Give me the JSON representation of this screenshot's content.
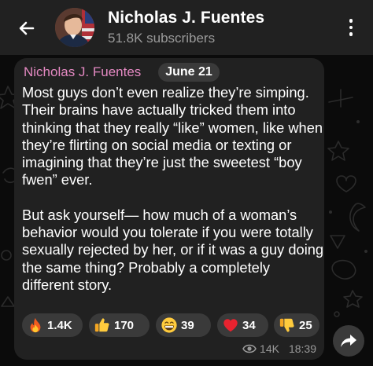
{
  "header": {
    "channel_name": "Nicholas J. Fuentes",
    "subscribers": "51.8K subscribers",
    "back_icon": "arrow-left-icon",
    "menu_icon": "more-vertical-icon"
  },
  "message": {
    "author": "Nicholas J. Fuentes",
    "date": "June 21",
    "paragraphs": [
      "Most guys don’t even realize they’re simping. Their brains have actually tricked them into thinking that they really “like” women, like when they’re flirting on social media or texting or imagining that they’re just the sweetest “boy fwen” ever.",
      "But ask yourself— how much of a woman’s behavior would you tolerate if you were totally sexually rejected by her, or if it was a guy doing the same thing? Probably a completely different story."
    ],
    "reactions": [
      {
        "icon": "fire-icon",
        "count": "1.4K"
      },
      {
        "icon": "thumbs-up-icon",
        "count": "170"
      },
      {
        "icon": "grinning-face-icon",
        "count": "39"
      },
      {
        "icon": "heart-icon",
        "count": "34"
      },
      {
        "icon": "thumbs-down-icon",
        "count": "25"
      }
    ],
    "views": "14K",
    "time": "18:39"
  },
  "colors": {
    "background": "#0b0b0b",
    "header": "#212121",
    "bubble": "#212121",
    "author_name": "#e489c2",
    "chip": "#3a3a3a",
    "muted_text": "#9a9a9a"
  },
  "share_icon": "share-arrow-icon"
}
